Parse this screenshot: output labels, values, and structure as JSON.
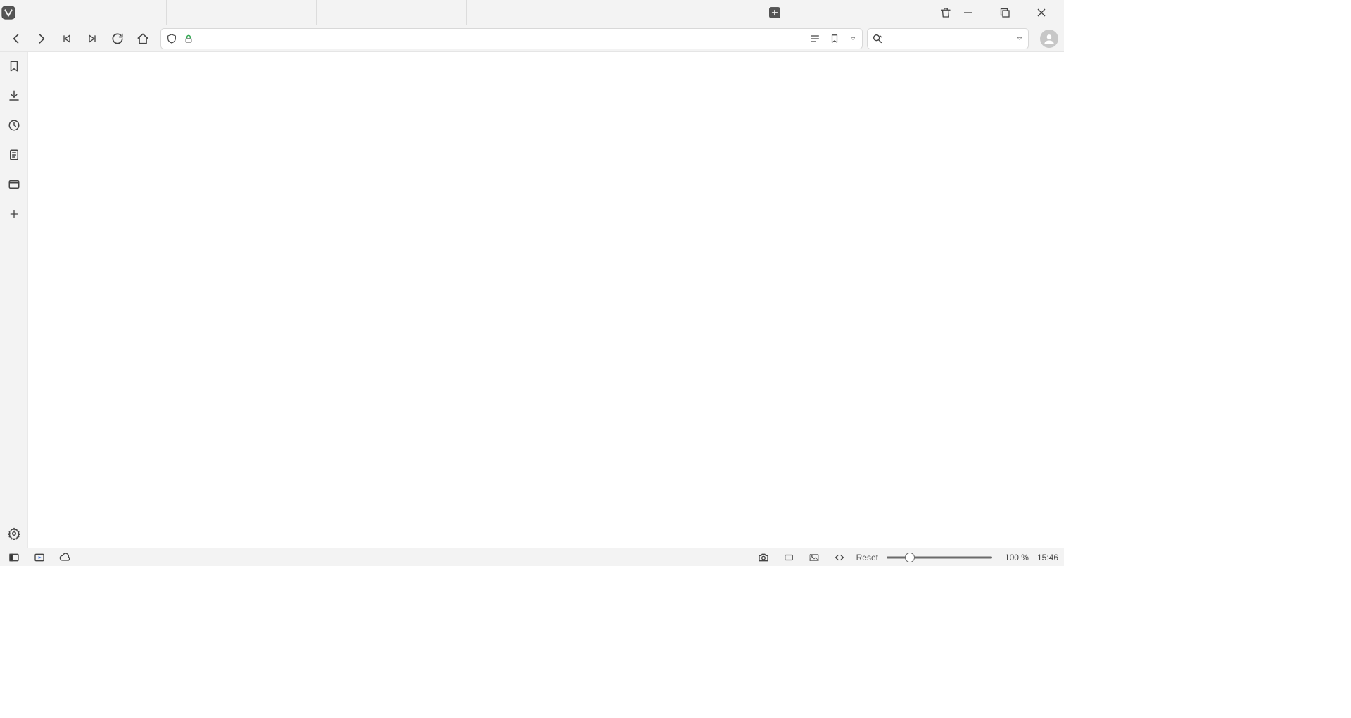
{
  "tab_count": 5,
  "address_bar": {
    "value": "",
    "placeholder": ""
  },
  "search_field": {
    "value": "",
    "placeholder": ""
  },
  "status_bar": {
    "zoom_reset_label": "Reset",
    "zoom_percent": "100 %",
    "zoom_slider_pct": 22,
    "clock": "15:46"
  },
  "icons": {
    "shield": "shield-icon",
    "lock": "lock-icon"
  }
}
